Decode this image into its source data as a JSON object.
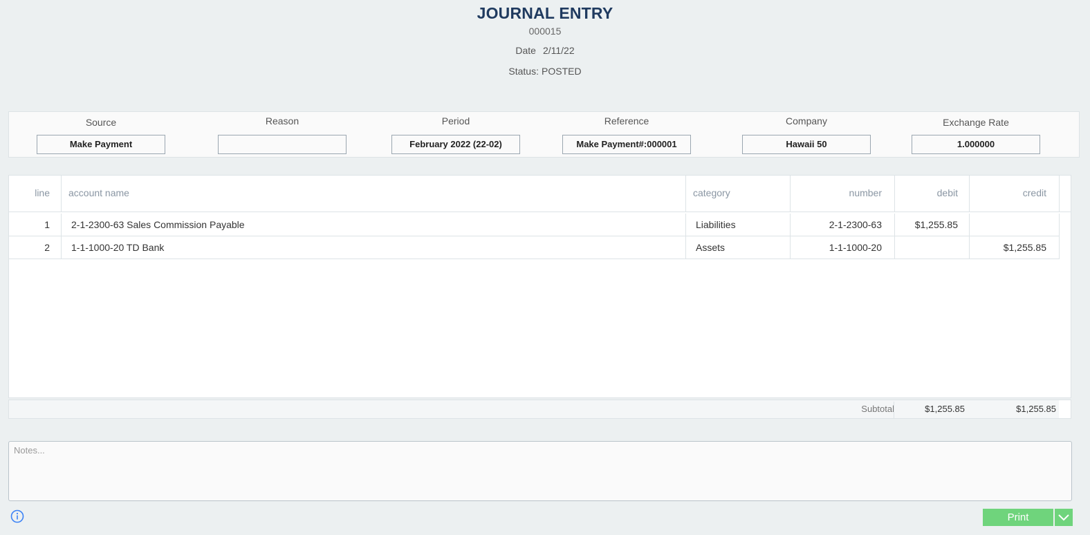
{
  "header": {
    "title": "JOURNAL ENTRY",
    "doc_number": "000015",
    "date_label": "Date",
    "date_value": "2/11/22",
    "status_label": "Status:",
    "status_value": "POSTED"
  },
  "fields": {
    "source": {
      "label": "Source",
      "value": "Make Payment"
    },
    "reason": {
      "label": "Reason",
      "value": ""
    },
    "period": {
      "label": "Period",
      "value": "February 2022 (22-02)"
    },
    "reference": {
      "label": "Reference",
      "value": "Make Payment#:000001"
    },
    "company": {
      "label": "Company",
      "value": "Hawaii 50"
    },
    "exchange_rate": {
      "label": "Exchange Rate",
      "value": "1.000000"
    }
  },
  "table": {
    "headers": {
      "line": "line",
      "account_name": "account name",
      "category": "category",
      "number": "number",
      "debit": "debit",
      "credit": "credit"
    },
    "rows": [
      {
        "line": "1",
        "account_name": "2-1-2300-63 Sales Commission Payable",
        "category": "Liabilities",
        "number": "2-1-2300-63",
        "debit": "$1,255.85",
        "credit": ""
      },
      {
        "line": "2",
        "account_name": "1-1-1000-20 TD Bank",
        "category": "Assets",
        "number": "1-1-1000-20",
        "debit": "",
        "credit": "$1,255.85"
      }
    ]
  },
  "subtotal": {
    "label": "Subtotal",
    "debit": "$1,255.85",
    "credit": "$1,255.85"
  },
  "notes": {
    "placeholder": "Notes...",
    "value": ""
  },
  "footer": {
    "info_icon": "info-circle-icon",
    "print_label": "Print",
    "dropdown_icon": "chevron-down-icon"
  },
  "colors": {
    "title": "#1f3a5f",
    "print_button": "#6fd47c",
    "info_icon": "#3b82f6",
    "background": "#ecf0f1"
  }
}
